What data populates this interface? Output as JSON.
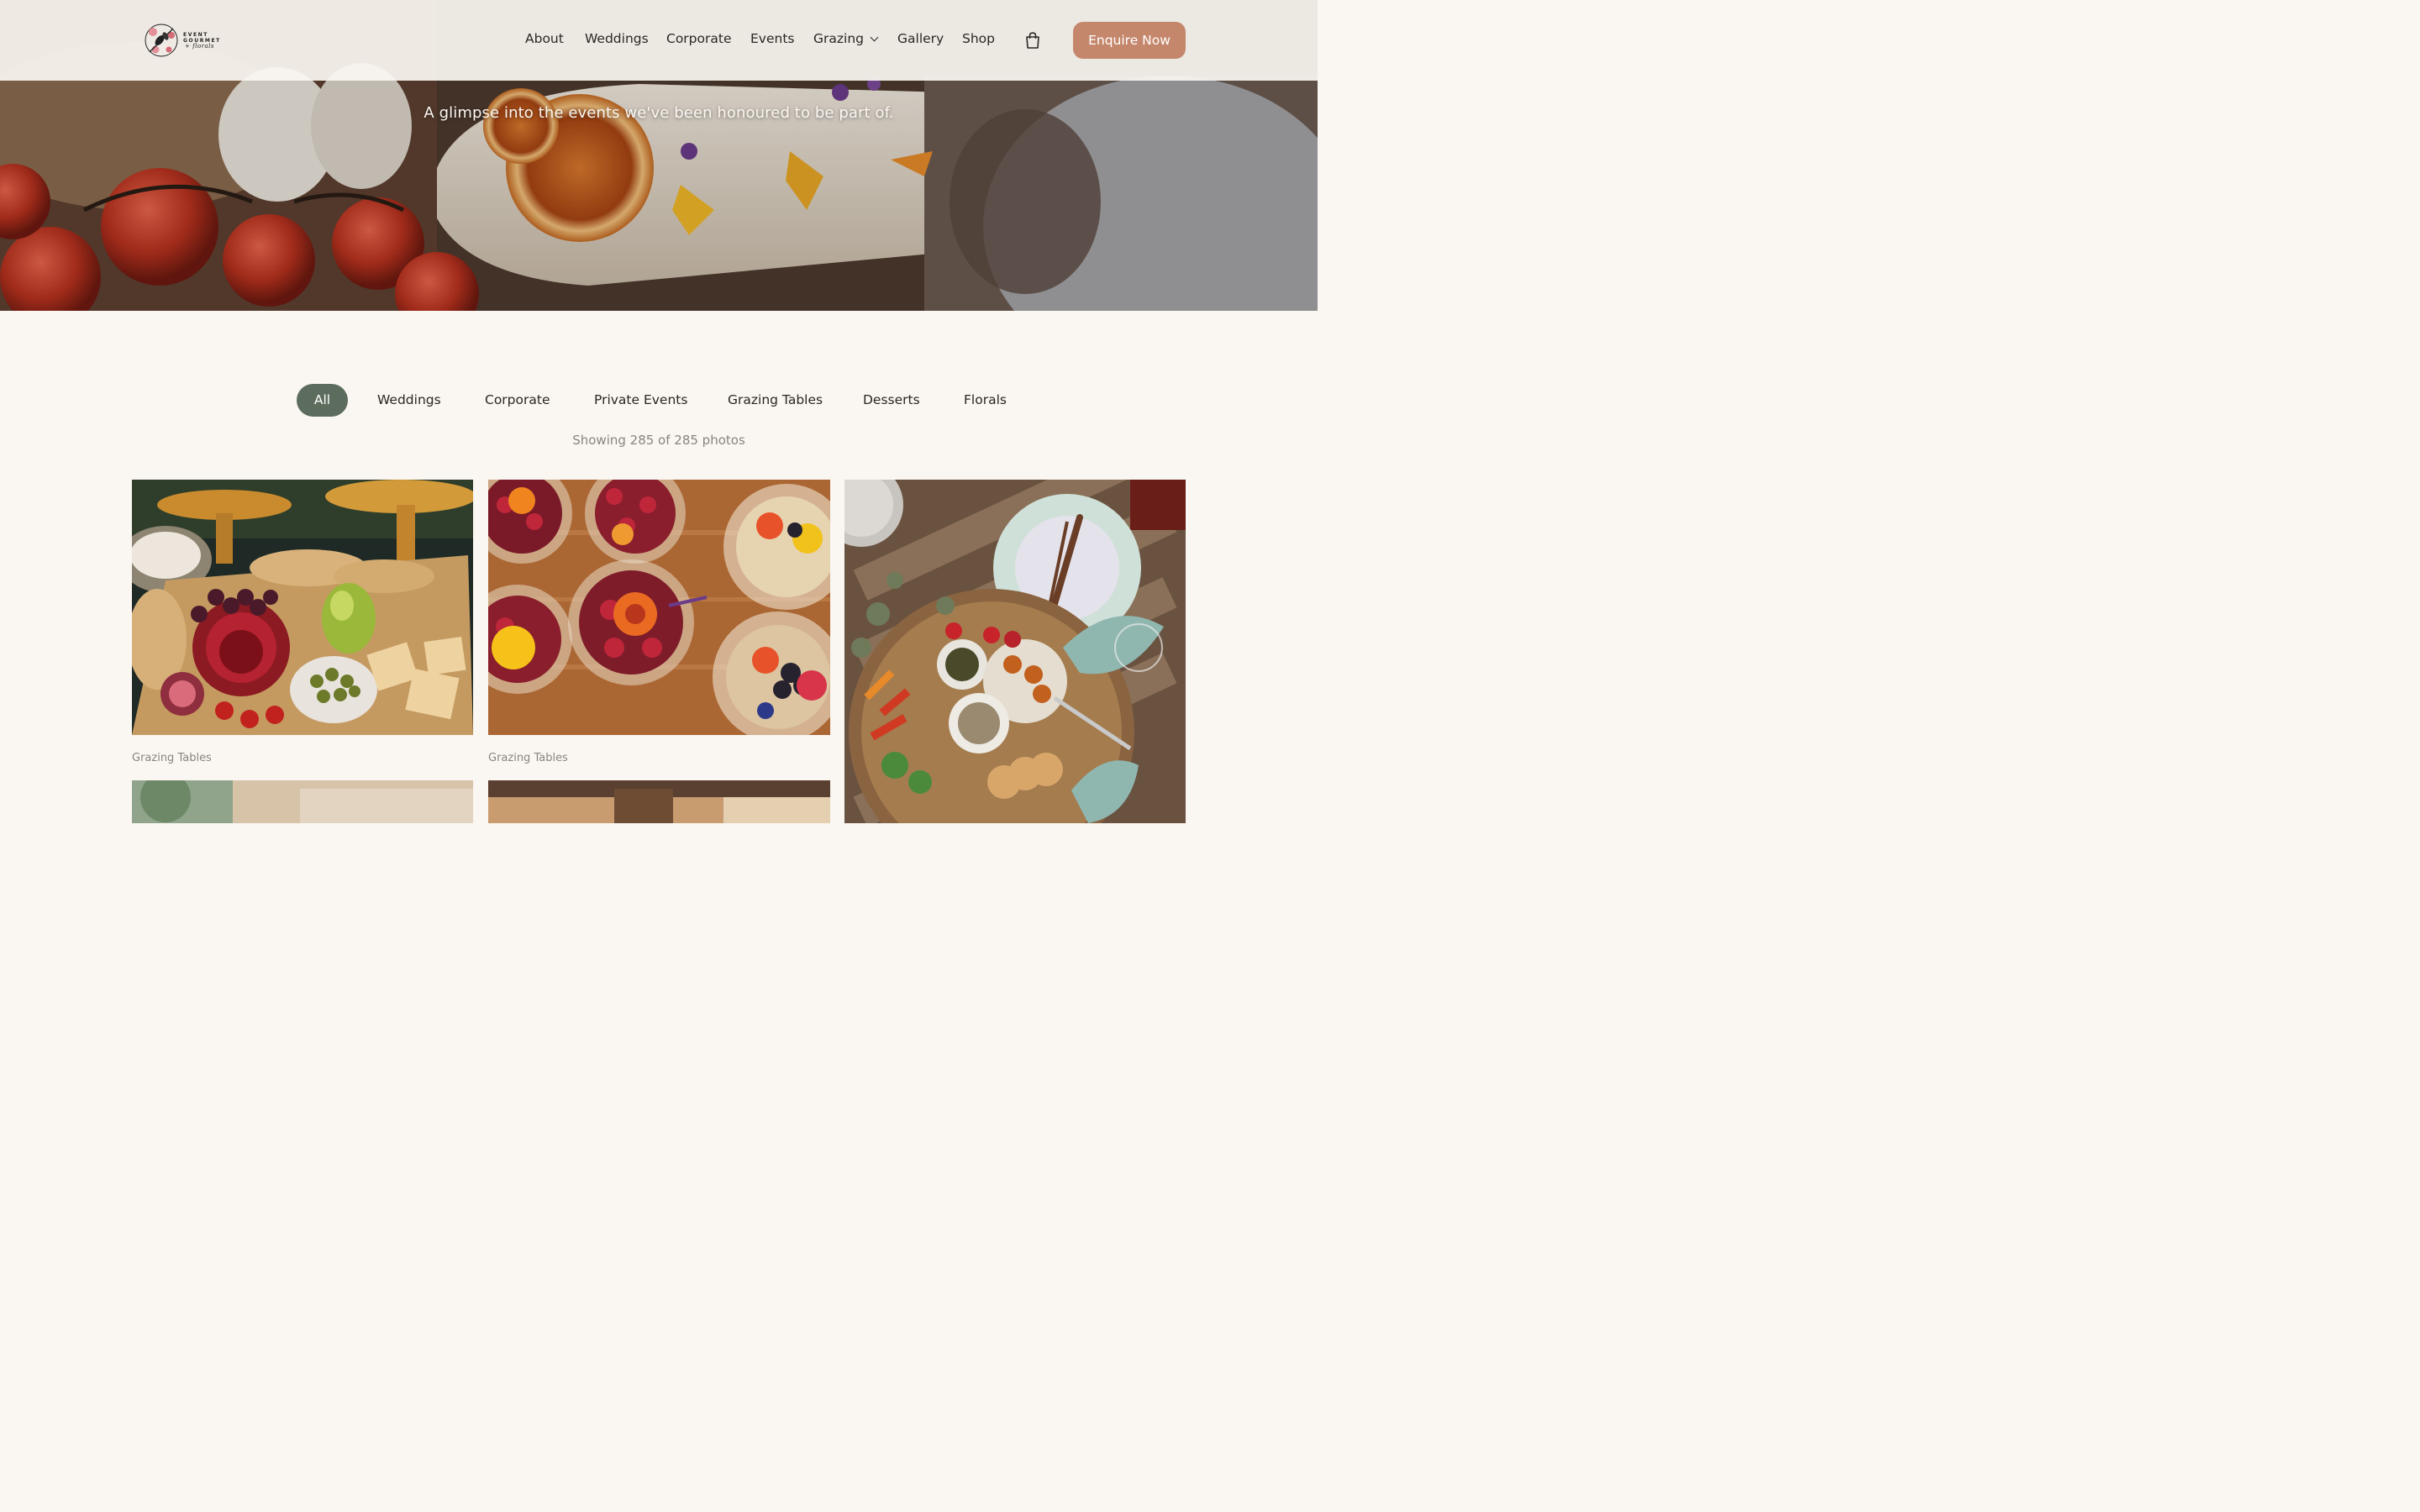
{
  "header": {
    "logo": {
      "line1": "EVENT",
      "line2": "GOURMET",
      "line3": "+ florals"
    },
    "nav": [
      {
        "label": "About"
      },
      {
        "label": "Weddings"
      },
      {
        "label": "Corporate"
      },
      {
        "label": "Events"
      },
      {
        "label": "Grazing",
        "has_dropdown": true
      },
      {
        "label": "Gallery"
      },
      {
        "label": "Shop"
      }
    ],
    "cart_icon": "shopping-bag-icon",
    "cta_label": "Enquire Now"
  },
  "hero": {
    "tagline": "A glimpse into the events we've been honoured to be part of."
  },
  "filters": {
    "items": [
      "All",
      "Weddings",
      "Corporate",
      "Private Events",
      "Grazing Tables",
      "Desserts",
      "Florals"
    ],
    "active": "All",
    "count_text": "Showing 285 of 285 photos"
  },
  "gallery": {
    "items": [
      {
        "caption": "Grazing Tables"
      },
      {
        "caption": "Grazing Tables"
      },
      {
        "caption": ""
      },
      {
        "caption": ""
      },
      {
        "caption": ""
      }
    ]
  },
  "colors": {
    "background": "#faf6f1",
    "accent": "#c5876c",
    "active_filter": "#5c6d5d",
    "muted_text": "#8a847e"
  }
}
